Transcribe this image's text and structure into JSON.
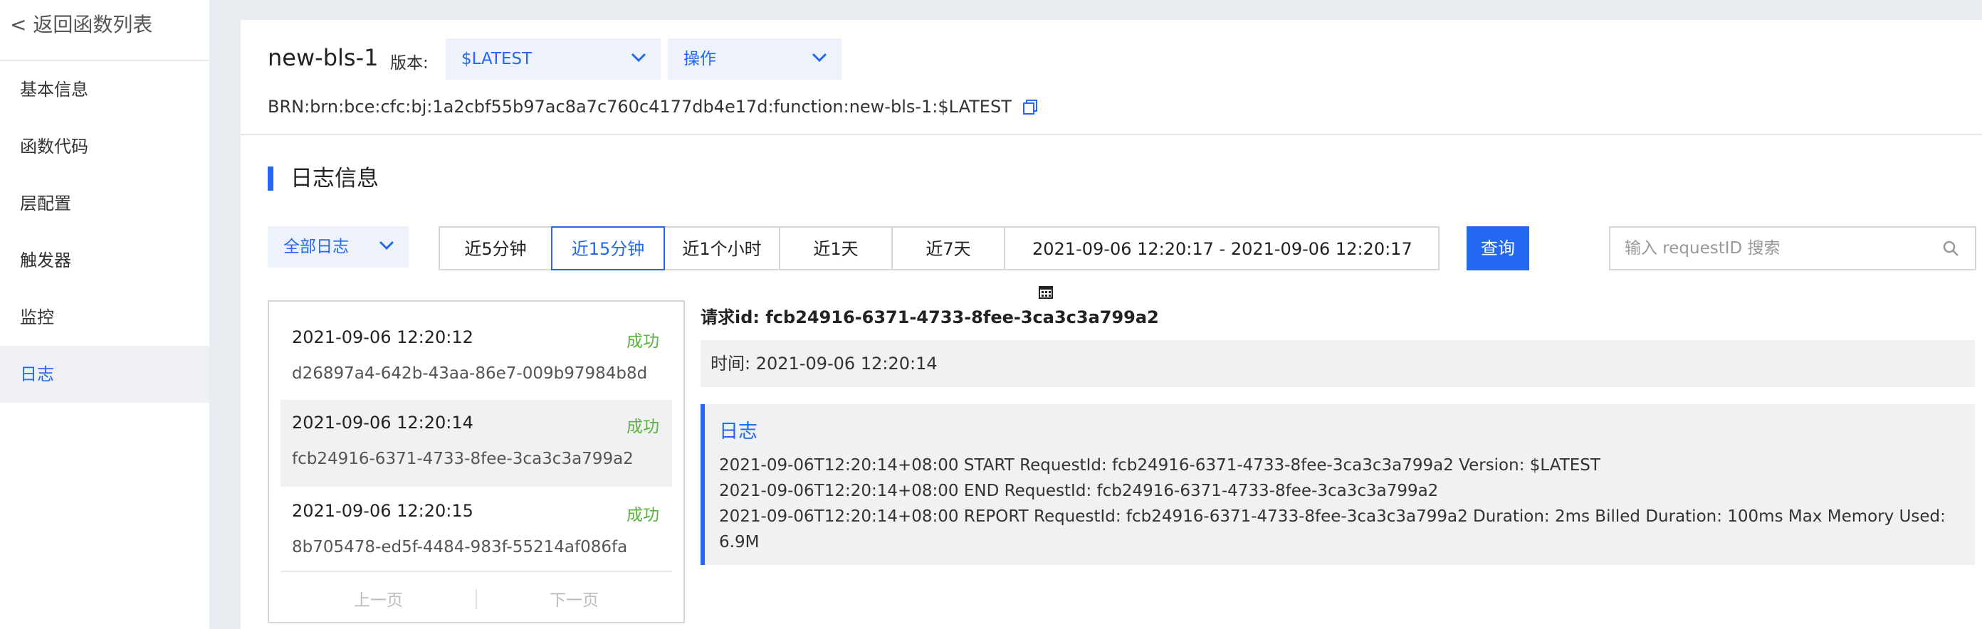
{
  "sidebar": {
    "back": "< 返回函数列表",
    "items": [
      {
        "label": "基本信息"
      },
      {
        "label": "函数代码"
      },
      {
        "label": "层配置"
      },
      {
        "label": "触发器"
      },
      {
        "label": "监控"
      },
      {
        "label": "日志"
      }
    ],
    "active_item": "日志"
  },
  "header": {
    "function_name": "new-bls-1",
    "version_label": "版本:",
    "version_value": "$LATEST",
    "action_label": "操作",
    "brn": "BRN:brn:bce:cfc:bj:1a2cbf55b97ac8a7c760c4177db4e17d:function:new-bls-1:$LATEST"
  },
  "logs": {
    "section_title": "日志信息",
    "filter": "全部日志",
    "ranges": [
      "近5分钟",
      "近15分钟",
      "近1个小时",
      "近1天",
      "近7天"
    ],
    "active_range": "近15分钟",
    "date_range": "2021-09-06 12:20:17 - 2021-09-06 12:20:17",
    "query_button": "查询",
    "search_placeholder": "输入 requestID 搜索",
    "list": [
      {
        "time": "2021-09-06 12:20:12",
        "status": "成功",
        "id": "d26897a4-642b-43aa-86e7-009b97984b8d"
      },
      {
        "time": "2021-09-06 12:20:14",
        "status": "成功",
        "id": "fcb24916-6371-4733-8fee-3ca3c3a799a2"
      },
      {
        "time": "2021-09-06 12:20:15",
        "status": "成功",
        "id": "8b705478-ed5f-4484-983f-55214af086fa"
      }
    ],
    "selected_index": 1,
    "pager": {
      "prev": "上一页",
      "next": "下一页"
    },
    "detail": {
      "request_id": "请求id: fcb24916-6371-4733-8fee-3ca3c3a799a2",
      "time": "时间: 2021-09-06 12:20:14",
      "log_title": "日志",
      "lines": [
        "2021-09-06T12:20:14+08:00 START RequestId: fcb24916-6371-4733-8fee-3ca3c3a799a2 Version: $LATEST",
        "2021-09-06T12:20:14+08:00 END RequestId: fcb24916-6371-4733-8fee-3ca3c3a799a2",
        "2021-09-06T12:20:14+08:00 REPORT RequestId: fcb24916-6371-4733-8fee-3ca3c3a799a2    Duration: 2ms Billed Duration: 100ms   Max Memory Used: 6.9M"
      ]
    }
  },
  "colors": {
    "accent": "#2468f2",
    "success": "#59b23c",
    "page_bg": "#e9edf2",
    "panel_bg": "#f0f1f3"
  },
  "icons": [
    "chevron-down-icon",
    "copy-icon",
    "calendar-icon",
    "search-icon"
  ]
}
